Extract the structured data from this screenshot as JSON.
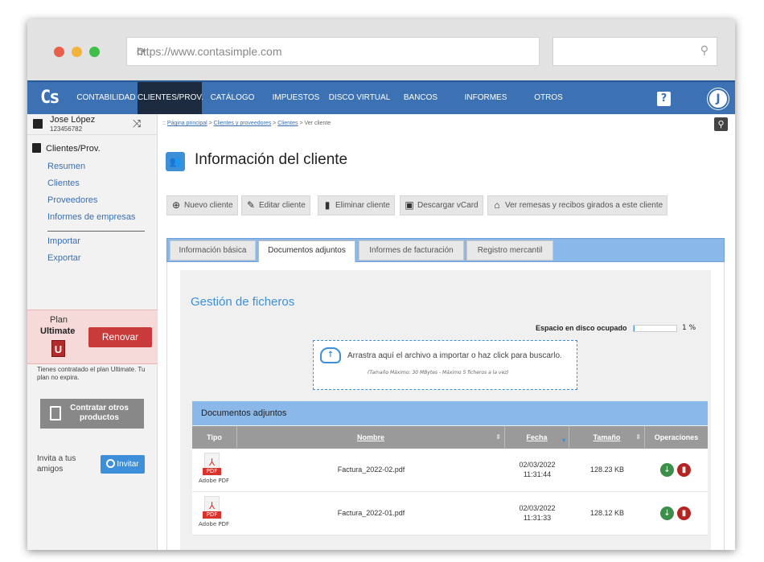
{
  "browser": {
    "url": "https://www.contasimple.com",
    "dot_colors": [
      "#e8604b",
      "#f4b43c",
      "#3fbf4a"
    ]
  },
  "nav": {
    "logo": "Cs",
    "items": [
      {
        "label": "CONTABILIDAD",
        "active": false
      },
      {
        "label": "CLIENTES/PROV.",
        "active": true
      },
      {
        "label": "CATÁLOGO",
        "active": false
      },
      {
        "label": "IMPUESTOS",
        "active": false
      },
      {
        "label": "DISCO VIRTUAL",
        "active": false
      },
      {
        "label": "BANCOS",
        "active": false
      },
      {
        "label": "INFORMES",
        "active": false
      },
      {
        "label": "OTROS",
        "active": false
      }
    ],
    "help": "?",
    "avatar": "J"
  },
  "sidebar": {
    "user_name": "Jose López",
    "user_nif": "123456782",
    "section_title": "Clientes/Prov.",
    "links": [
      "Resumen",
      "Clientes",
      "Proveedores",
      "Informes de empresas"
    ],
    "links2": [
      "Importar",
      "Exportar"
    ],
    "plan_label": "Plan",
    "plan_name": "Ultimate",
    "plan_badge": "U",
    "renew_label": "Renovar",
    "plan_note": "Tienes contratado el plan Ultimate. Tu plan no expira.",
    "contract_label": "Contratar otros productos",
    "invite_text": "Invita a tus amigos",
    "invite_label": "Invitar"
  },
  "breadcrumb": {
    "prefix": ":: ",
    "items": [
      "Página principal",
      "Clientes y proveedores",
      "Clientes"
    ],
    "current": "Ver cliente",
    "sep": " > "
  },
  "page": {
    "title": "Información del cliente"
  },
  "actions": [
    {
      "label": "Nuevo cliente",
      "icon": "plus-circle-icon"
    },
    {
      "label": "Editar cliente",
      "icon": "pencil-icon"
    },
    {
      "label": "Eliminar cliente",
      "icon": "trash-icon"
    },
    {
      "label": "Descargar vCard",
      "icon": "vcard-icon"
    },
    {
      "label": "Ver remesas y recibos girados a este cliente",
      "icon": "bank-icon"
    }
  ],
  "tabs": [
    {
      "label": "Información básica",
      "active": false
    },
    {
      "label": "Documentos adjuntos",
      "active": true
    },
    {
      "label": "Informes de facturación",
      "active": false
    },
    {
      "label": "Registro mercantil",
      "active": false
    }
  ],
  "files": {
    "title": "Gestión de ficheros",
    "disk_label": "Espacio en disco ocupado",
    "disk_pct": "1 %",
    "disk_fraction": 0.01,
    "drop_text": "Arrastra aquí el archivo a importar o haz click para buscarlo.",
    "drop_sub": "(Tamaño Máximo: 30 MBytes - Máximo 5 ficheros a la vez)"
  },
  "table": {
    "title": "Documentos adjuntos",
    "columns": [
      "Tipo",
      "Nombre",
      "Fecha",
      "Tamaño",
      "Operaciones"
    ],
    "rows": [
      {
        "type": "PDF",
        "type_label": "Adobe PDF",
        "name": "Factura_2022-02.pdf",
        "date": "02/03/2022",
        "time": "11:31:44",
        "size": "128.23 KB"
      },
      {
        "type": "PDF",
        "type_label": "Adobe PDF",
        "name": "Factura_2022-01.pdf",
        "date": "02/03/2022",
        "time": "11:31:33",
        "size": "128.12 KB"
      }
    ]
  }
}
